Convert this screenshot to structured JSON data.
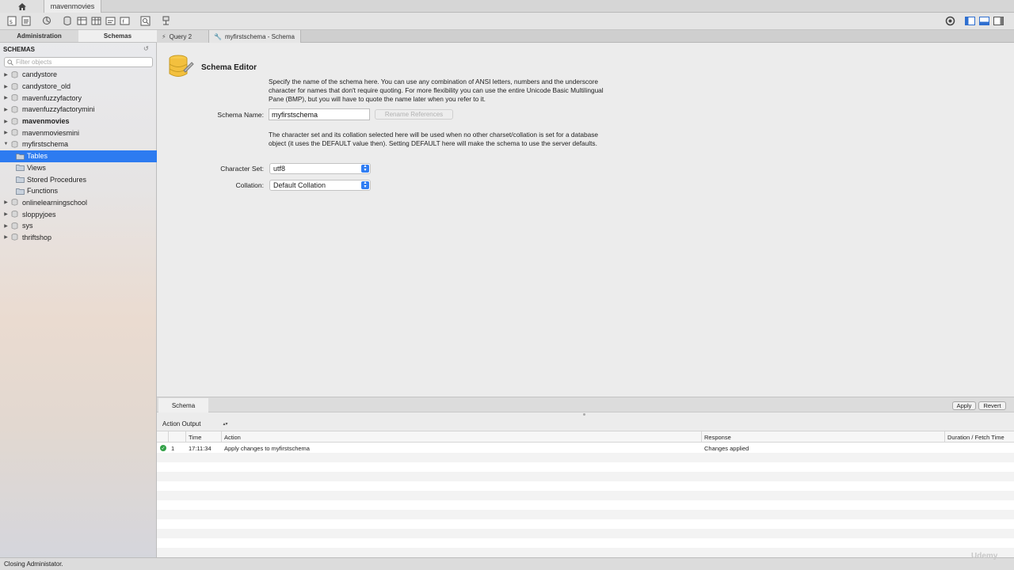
{
  "window": {
    "connection_tab": "mavenmovies"
  },
  "sidebar": {
    "tabs": [
      "Administration",
      "Schemas"
    ],
    "header": "SCHEMAS",
    "filter_placeholder": "Filter objects",
    "schemas": [
      {
        "name": "candystore",
        "bold": false
      },
      {
        "name": "candystore_old",
        "bold": false
      },
      {
        "name": "mavenfuzzyfactory",
        "bold": false
      },
      {
        "name": "mavenfuzzyfactorymini",
        "bold": false
      },
      {
        "name": "mavenmovies",
        "bold": true
      },
      {
        "name": "mavenmoviesmini",
        "bold": false
      },
      {
        "name": "myfirstschema",
        "bold": false,
        "expanded": true
      },
      {
        "name": "onlinelearningschool",
        "bold": false
      },
      {
        "name": "sloppyjoes",
        "bold": false
      },
      {
        "name": "sys",
        "bold": false
      },
      {
        "name": "thriftshop",
        "bold": false
      }
    ],
    "children": [
      "Tables",
      "Views",
      "Stored Procedures",
      "Functions"
    ],
    "selected_child": "Tables"
  },
  "editor_tabs": [
    "Query 2",
    "myfirstschema - Schema"
  ],
  "editor": {
    "title": "Schema Editor",
    "desc1": "Specify the name of the schema here. You can use any combination of ANSI letters, numbers and the underscore character for names that don't require quoting. For more flexibility you can use the entire Unicode Basic Multilingual Pane (BMP), but you will have to quote the name later when you refer to it.",
    "schema_name_label": "Schema Name:",
    "schema_name_value": "myfirstschema",
    "rename_button": "Rename References",
    "desc2": "The character set and its collation selected here will be used when no other charset/collation is set for a database object (it uses the DEFAULT value then). Setting DEFAULT here will make the schema to use the server defaults.",
    "charset_label": "Character Set:",
    "charset_value": "utf8",
    "collation_label": "Collation:",
    "collation_value": "Default Collation"
  },
  "bottom": {
    "tab": "Schema",
    "apply": "Apply",
    "revert": "Revert"
  },
  "output": {
    "selector": "Action Output",
    "columns": [
      "Time",
      "Action",
      "Response",
      "Duration / Fetch Time"
    ],
    "rows": [
      {
        "index": "1",
        "time": "17:11:34",
        "action": "Apply changes to myfirstschema",
        "response": "Changes applied",
        "duration": ""
      }
    ]
  },
  "status": "Closing Administator.",
  "watermark": "Udemy",
  "colors": {
    "selection": "#2d7bf0",
    "ok": "#33a148"
  }
}
